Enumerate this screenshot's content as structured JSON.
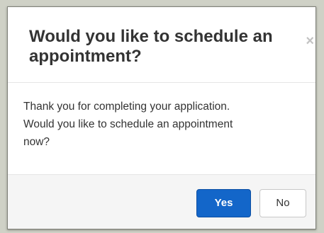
{
  "dialog": {
    "title": "Would you like to schedule an appointment?",
    "close_symbol": "×",
    "message_line1": "Thank you for completing your application.",
    "message_line2": "Would you like to schedule an appointment",
    "message_line3": "now?",
    "buttons": {
      "yes_label": "Yes",
      "no_label": "No"
    }
  },
  "colors": {
    "backdrop": "#cfd1c6",
    "primary_button": "#1366c9",
    "footer_background": "#f5f5f5"
  },
  "icons": {
    "close": "close-icon"
  }
}
